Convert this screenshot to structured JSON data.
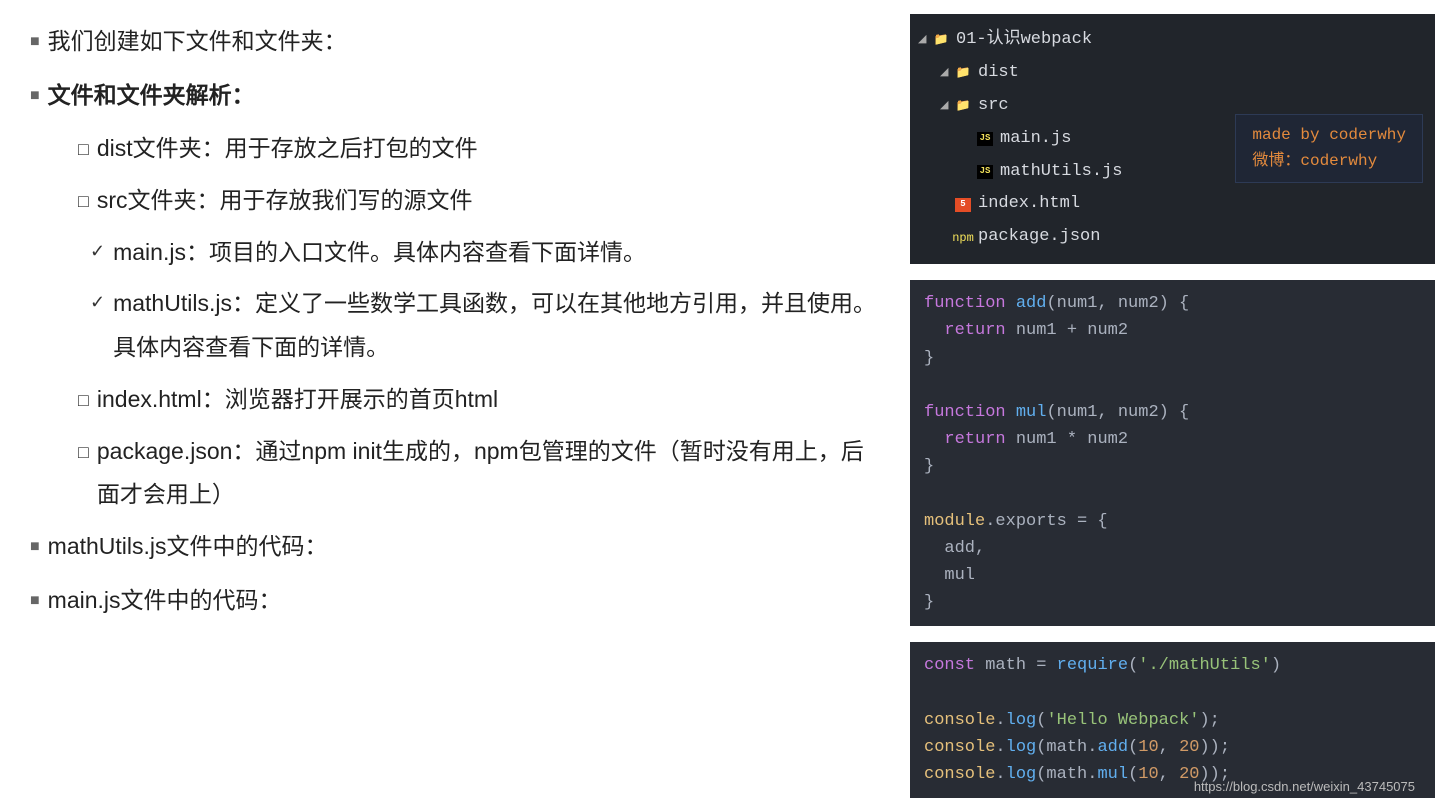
{
  "left": {
    "b1": "我们创建如下文件和文件夹：",
    "b2": "文件和文件夹解析：",
    "s1": "dist文件夹：用于存放之后打包的文件",
    "s2": "src文件夹：用于存放我们写的源文件",
    "c1": "main.js：项目的入口文件。具体内容查看下面详情。",
    "c2": "mathUtils.js：定义了一些数学工具函数，可以在其他地方引用，并且使用。具体内容查看下面的详情。",
    "s3": "index.html：浏览器打开展示的首页html",
    "s4": "package.json：通过npm init生成的，npm包管理的文件（暂时没有用上，后面才会用上）",
    "b3": "mathUtils.js文件中的代码：",
    "b4": "main.js文件中的代码："
  },
  "tree": {
    "root": "01-认识webpack",
    "dist": "dist",
    "src": "src",
    "main": "main.js",
    "mathutils": "mathUtils.js",
    "index": "index.html",
    "pkg": "package.json"
  },
  "badge": {
    "l1": "made by coderwhy",
    "l2": "微博：coderwhy"
  },
  "code1": {
    "l1a": "function",
    "l1b": "add",
    "l1c": "(num1, num2) {",
    "l2a": "return",
    "l2b": " num1 + num2",
    "l3": "}",
    "l4": "",
    "l5a": "function",
    "l5b": "mul",
    "l5c": "(num1, num2) {",
    "l6a": "return",
    "l6b": " num1 * num2",
    "l7": "}",
    "l8": "",
    "l9a": "module",
    "l9b": ".exports = {",
    "l10": "  add,",
    "l11": "  mul",
    "l12": "}"
  },
  "code2": {
    "l1a": "const",
    "l1b": " math = ",
    "l1c": "require",
    "l1d": "(",
    "l1e": "'./mathUtils'",
    "l1f": ")",
    "l2": "",
    "l3a": "console",
    "l3b": ".",
    "l3c": "log",
    "l3d": "(",
    "l3e": "'Hello Webpack'",
    "l3f": ");",
    "l4a": "console",
    "l4b": ".",
    "l4c": "log",
    "l4d": "(math.",
    "l4e": "add",
    "l4f": "(",
    "l4g": "10",
    "l4h": ", ",
    "l4i": "20",
    "l4j": "));",
    "l5a": "console",
    "l5b": ".",
    "l5c": "log",
    "l5d": "(math.",
    "l5e": "mul",
    "l5f": "(",
    "l5g": "10",
    "l5h": ", ",
    "l5i": "20",
    "l5j": "));"
  },
  "watermark": "https://blog.csdn.net/weixin_43745075"
}
